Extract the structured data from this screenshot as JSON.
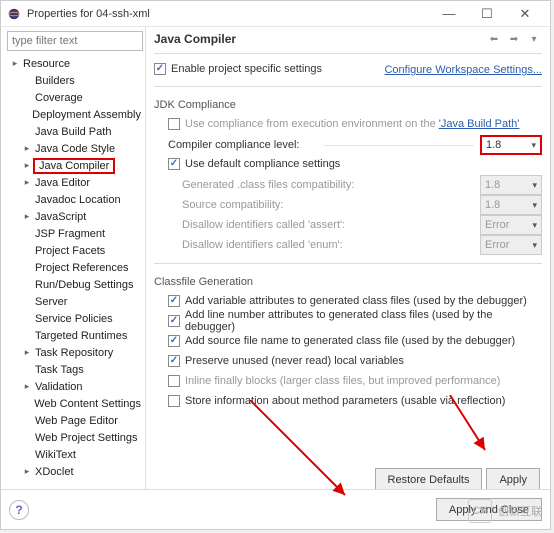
{
  "window": {
    "title": "Properties for 04-ssh-xml",
    "minimize_icon": "—",
    "maximize_icon": "☐",
    "close_icon": "✕"
  },
  "filter_placeholder": "type filter text",
  "tree": {
    "root": "Resource",
    "items": [
      "Builders",
      "Coverage",
      "Deployment Assembly",
      "Java Build Path",
      "Java Code Style",
      "Java Compiler",
      "Java Editor",
      "Javadoc Location",
      "JavaScript",
      "JSP Fragment",
      "Project Facets",
      "Project References",
      "Run/Debug Settings",
      "Server",
      "Service Policies",
      "Targeted Runtimes",
      "Task Repository",
      "Task Tags",
      "Validation",
      "Web Content Settings",
      "Web Page Editor",
      "Web Project Settings",
      "WikiText",
      "XDoclet"
    ],
    "selected": "Java Compiler",
    "expandables": [
      "Java Code Style",
      "Java Compiler",
      "Java Editor",
      "JavaScript",
      "Task Repository",
      "Validation",
      "XDoclet"
    ]
  },
  "page": {
    "title": "Java Compiler",
    "enable_project_specific": "Enable project specific settings",
    "configure_workspace": "Configure Workspace Settings...",
    "jdk_group": "JDK Compliance",
    "use_compliance_env": "Use compliance from execution environment on the",
    "java_build_path_link": "'Java Build Path'",
    "compiler_compliance_level": "Compiler compliance level:",
    "compliance_value": "1.8",
    "use_default_compliance": "Use default compliance settings",
    "generated_class_compat": "Generated .class files compatibility:",
    "generated_class_value": "1.8",
    "source_compat": "Source compatibility:",
    "source_value": "1.8",
    "disallow_assert": "Disallow identifiers called 'assert':",
    "disallow_assert_value": "Error",
    "disallow_enum": "Disallow identifiers called 'enum':",
    "disallow_enum_value": "Error",
    "classfile_group": "Classfile Generation",
    "cf_var_attrs": "Add variable attributes to generated class files (used by the debugger)",
    "cf_line_numbers": "Add line number attributes to generated class files (used by the debugger)",
    "cf_source_file": "Add source file name to generated class file (used by the debugger)",
    "cf_preserve_unused": "Preserve unused (never read) local variables",
    "cf_inline_finally": "Inline finally blocks (larger class files, but improved performance)",
    "cf_store_method_params": "Store information about method parameters (usable via reflection)",
    "restore_defaults": "Restore Defaults",
    "apply": "Apply"
  },
  "footer": {
    "apply_and_close": "Apply and Close"
  },
  "watermark": "创新互联"
}
